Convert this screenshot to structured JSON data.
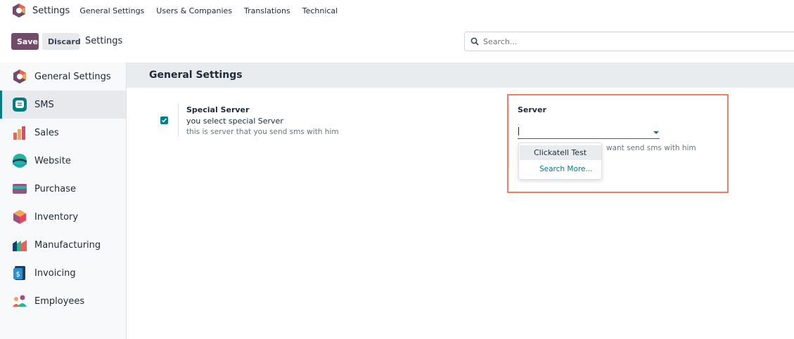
{
  "topnav": {
    "app_title": "Settings",
    "menu": [
      "General Settings",
      "Users & Companies",
      "Translations",
      "Technical"
    ]
  },
  "controlbar": {
    "save_label": "Save",
    "discard_label": "Discard",
    "breadcrumb": "Settings",
    "search_placeholder": "Search..."
  },
  "sidebar": {
    "items": [
      {
        "label": "General Settings",
        "icon": "settings-app-icon"
      },
      {
        "label": "SMS",
        "icon": "sms-app-icon",
        "active": true
      },
      {
        "label": "Sales",
        "icon": "sales-app-icon"
      },
      {
        "label": "Website",
        "icon": "website-app-icon"
      },
      {
        "label": "Purchase",
        "icon": "purchase-app-icon"
      },
      {
        "label": "Inventory",
        "icon": "inventory-app-icon"
      },
      {
        "label": "Manufacturing",
        "icon": "manufacturing-app-icon"
      },
      {
        "label": "Invoicing",
        "icon": "invoicing-app-icon"
      },
      {
        "label": "Employees",
        "icon": "employees-app-icon"
      }
    ]
  },
  "main": {
    "section_title": "General Settings",
    "special_server": {
      "title": "Special Server",
      "value": "you select special Server",
      "help": "this is server that you send sms with him",
      "checked": true
    },
    "server": {
      "label": "Server",
      "input_value": "",
      "help_visible": "want send sms with him"
    },
    "dropdown": {
      "options": [
        "Clickatell Test"
      ],
      "search_more": "Search More..."
    }
  },
  "colors": {
    "primary": "#714b67",
    "accent": "#017e84",
    "highlight": "#f47c66"
  }
}
